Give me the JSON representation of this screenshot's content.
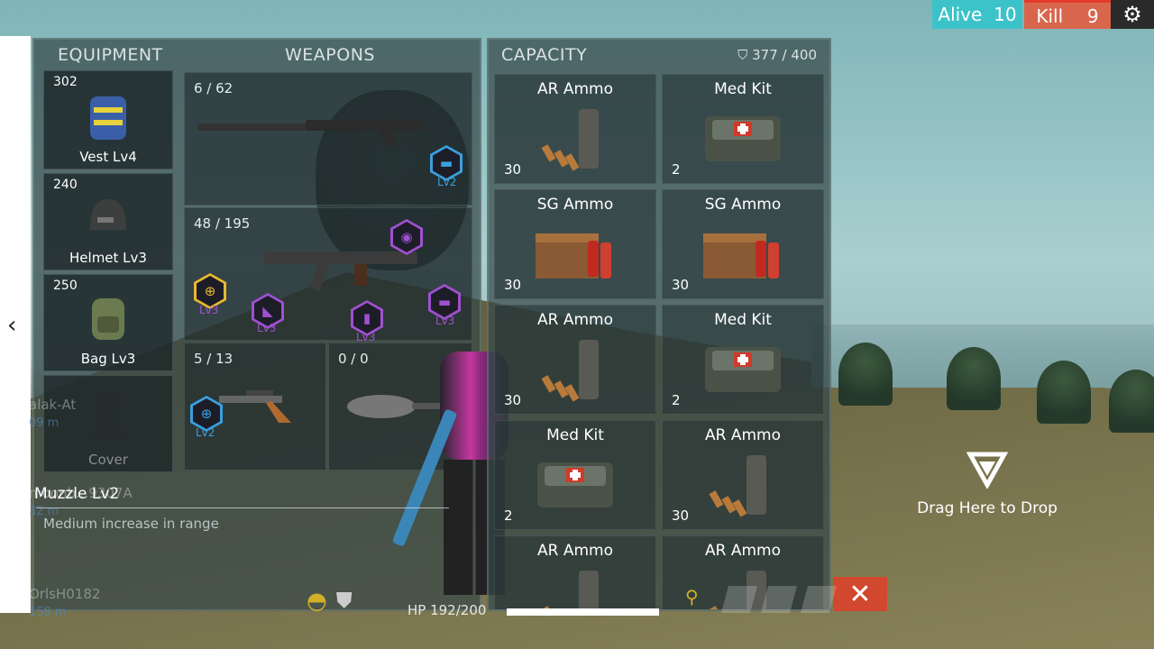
{
  "hud": {
    "alive_label": "Alive",
    "alive_count": "10",
    "kill_label": "Kill",
    "kill_count": "9",
    "colors": {
      "alive": "#3cc3c9",
      "kill": "#d8664c",
      "close": "#d1482e"
    }
  },
  "equipment": {
    "header": "EQUIPMENT",
    "slots": [
      {
        "value": "302",
        "label": "Vest Lv4",
        "icon": "vest-icon"
      },
      {
        "value": "240",
        "label": "Helmet Lv3",
        "icon": "helmet-icon"
      },
      {
        "value": "250",
        "label": "Bag Lv3",
        "icon": "backpack-icon"
      },
      {
        "value": "",
        "label": "Cover",
        "icon": "character-silhouette-icon"
      }
    ]
  },
  "weapons": {
    "header": "WEAPONS",
    "slots": [
      {
        "ammo": "6 / 62",
        "icon": "shotgun-icon",
        "attachments": [
          {
            "level": "Lv2",
            "icon": "stock-icon",
            "color": "#3aa0e0"
          }
        ]
      },
      {
        "ammo": "48 / 195",
        "icon": "rifle-icon",
        "attachments": [
          {
            "level": "Lv3",
            "icon": "muzzle-icon",
            "color": "#e8b830"
          },
          {
            "level": "Lv3",
            "icon": "foregrip-icon",
            "color": "#a050d0"
          },
          {
            "level": "Lv3",
            "icon": "magazine-icon",
            "color": "#a050d0"
          },
          {
            "level": "Lv3",
            "icon": "stock-icon",
            "color": "#a050d0"
          },
          {
            "level": "",
            "icon": "scope-icon",
            "color": "#a050d0"
          }
        ]
      },
      {
        "ammo": "5 / 13",
        "icon": "revolver-icon",
        "attachments": [
          {
            "level": "Lv2",
            "icon": "muzzle-icon",
            "color": "#3aa0e0"
          }
        ]
      },
      {
        "ammo": "0 / 0",
        "icon": "frying-pan-icon",
        "attachments": []
      }
    ]
  },
  "selected_attachment": {
    "title": "Muzzle Lv2",
    "description": "Medium increase in range"
  },
  "ghost_feed": {
    "name1": "alak-At",
    "dist1": "09 m",
    "name2": "moonb...9307A",
    "dist2": "32 m",
    "name3": "OrlsH0182",
    "dist3": "158 m"
  },
  "capacity": {
    "header": "CAPACITY",
    "used": "377 / 400",
    "items": [
      {
        "name": "AR Ammo",
        "qty": "30",
        "icon": "ar-ammo-icon"
      },
      {
        "name": "Med Kit",
        "qty": "2",
        "icon": "med-kit-icon"
      },
      {
        "name": "SG Ammo",
        "qty": "30",
        "icon": "sg-ammo-icon"
      },
      {
        "name": "SG Ammo",
        "qty": "30",
        "icon": "sg-ammo-icon"
      },
      {
        "name": "AR Ammo",
        "qty": "30",
        "icon": "ar-ammo-icon"
      },
      {
        "name": "Med Kit",
        "qty": "2",
        "icon": "med-kit-icon"
      },
      {
        "name": "Med Kit",
        "qty": "2",
        "icon": "med-kit-icon"
      },
      {
        "name": "AR Ammo",
        "qty": "30",
        "icon": "ar-ammo-icon"
      },
      {
        "name": "AR Ammo",
        "qty": "",
        "icon": "ar-ammo-icon"
      },
      {
        "name": "AR Ammo",
        "qty": "",
        "icon": "ar-ammo-icon"
      }
    ]
  },
  "drop_zone": {
    "label": "Drag Here to Drop"
  },
  "status": {
    "hp_text": "HP  192/200",
    "hp_fraction": 0.96
  }
}
